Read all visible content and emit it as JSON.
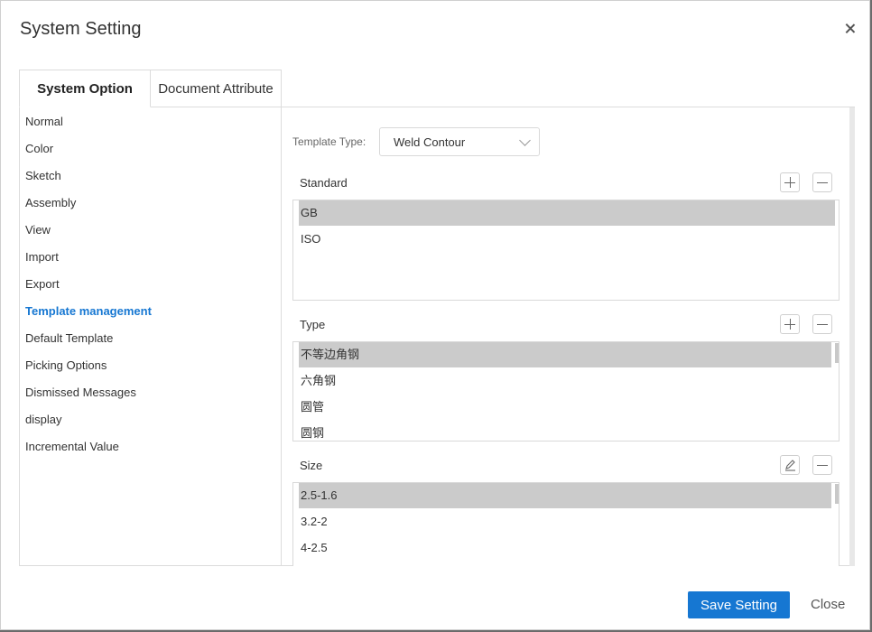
{
  "dialog": {
    "title": "System Setting"
  },
  "tabs": [
    {
      "label": "System Option",
      "active": true
    },
    {
      "label": "Document Attribute",
      "active": false
    }
  ],
  "sidebar": {
    "items": [
      {
        "label": "Normal"
      },
      {
        "label": "Color"
      },
      {
        "label": "Sketch"
      },
      {
        "label": "Assembly"
      },
      {
        "label": "View"
      },
      {
        "label": "Import"
      },
      {
        "label": "Export"
      },
      {
        "label": "Template management",
        "active": true
      },
      {
        "label": "Default Template"
      },
      {
        "label": "Picking Options"
      },
      {
        "label": "Dismissed Messages"
      },
      {
        "label": "display"
      },
      {
        "label": "Incremental Value"
      }
    ]
  },
  "template_type": {
    "label": "Template Type:",
    "value": "Weld Contour"
  },
  "standard": {
    "label": "Standard",
    "rows": [
      "GB",
      "ISO"
    ],
    "selected_index": 0
  },
  "type": {
    "label": "Type",
    "rows": [
      "不等边角钢",
      "六角钢",
      "圆管",
      "圆钢"
    ],
    "selected_index": 0
  },
  "size": {
    "label": "Size",
    "rows": [
      "2.5-1.6",
      "3.2-2",
      "4-2.5"
    ],
    "selected_index": 0
  },
  "footer": {
    "save_label": "Save Setting",
    "close_label": "Close"
  },
  "colors": {
    "accent": "#1677d2",
    "selected_row": "#cbcbcb",
    "border": "#d9d9d9"
  }
}
